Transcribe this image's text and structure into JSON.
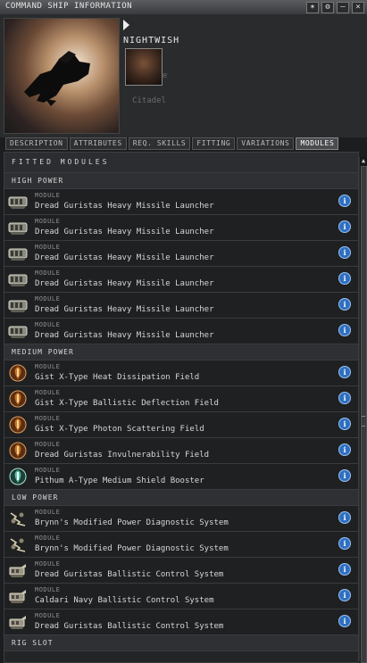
{
  "window": {
    "title": "COMMAND SHIP INFORMATION",
    "buttons": [
      "✶",
      "⚙",
      "–",
      "×"
    ]
  },
  "header": {
    "ship_name": "NIGHTWISH",
    "ghost_lines": [
      "e",
      "Citadel"
    ]
  },
  "tabs": [
    "DESCRIPTION",
    "ATTRIBUTES",
    "REQ. SKILLS",
    "FITTING",
    "VARIATIONS",
    "MODULES"
  ],
  "active_tab": "MODULES",
  "panel": {
    "title": "FITTED MODULES",
    "sections": [
      {
        "name": "HIGH POWER",
        "items": [
          {
            "label": "MODULE",
            "name": "Dread Guristas Heavy Missile Launcher",
            "icon": "launcher-icon"
          },
          {
            "label": "MODULE",
            "name": "Dread Guristas Heavy Missile Launcher",
            "icon": "launcher-icon"
          },
          {
            "label": "MODULE",
            "name": "Dread Guristas Heavy Missile Launcher",
            "icon": "launcher-icon"
          },
          {
            "label": "MODULE",
            "name": "Dread Guristas Heavy Missile Launcher",
            "icon": "launcher-icon"
          },
          {
            "label": "MODULE",
            "name": "Dread Guristas Heavy Missile Launcher",
            "icon": "launcher-icon"
          },
          {
            "label": "MODULE",
            "name": "Dread Guristas Heavy Missile Launcher",
            "icon": "launcher-icon"
          }
        ]
      },
      {
        "name": "MEDIUM POWER",
        "items": [
          {
            "label": "MODULE",
            "name": "Gist X-Type Heat Dissipation Field",
            "icon": "shield-hardener-icon"
          },
          {
            "label": "MODULE",
            "name": "Gist X-Type Ballistic Deflection Field",
            "icon": "shield-hardener-icon"
          },
          {
            "label": "MODULE",
            "name": "Gist X-Type Photon Scattering Field",
            "icon": "shield-hardener-icon"
          },
          {
            "label": "MODULE",
            "name": "Dread Guristas Invulnerability Field",
            "icon": "shield-hardener-icon"
          },
          {
            "label": "MODULE",
            "name": "Pithum A-Type Medium Shield Booster",
            "icon": "shield-booster-icon"
          }
        ]
      },
      {
        "name": "LOW POWER",
        "items": [
          {
            "label": "MODULE",
            "name": "Brynn's Modified Power Diagnostic System",
            "icon": "power-diagnostic-icon"
          },
          {
            "label": "MODULE",
            "name": "Brynn's Modified Power Diagnostic System",
            "icon": "power-diagnostic-icon"
          },
          {
            "label": "MODULE",
            "name": "Dread Guristas Ballistic Control System",
            "icon": "ballistic-control-icon"
          },
          {
            "label": "MODULE",
            "name": "Caldari Navy Ballistic Control System",
            "icon": "ballistic-control-icon"
          },
          {
            "label": "MODULE",
            "name": "Dread Guristas Ballistic Control System",
            "icon": "ballistic-control-icon"
          }
        ]
      },
      {
        "name": "RIG SLOT",
        "items": []
      }
    ]
  },
  "colors": {
    "info_blue": "#2e6fc2",
    "hardener_orange": "#c8741f",
    "booster_teal": "#5fbfa6"
  }
}
